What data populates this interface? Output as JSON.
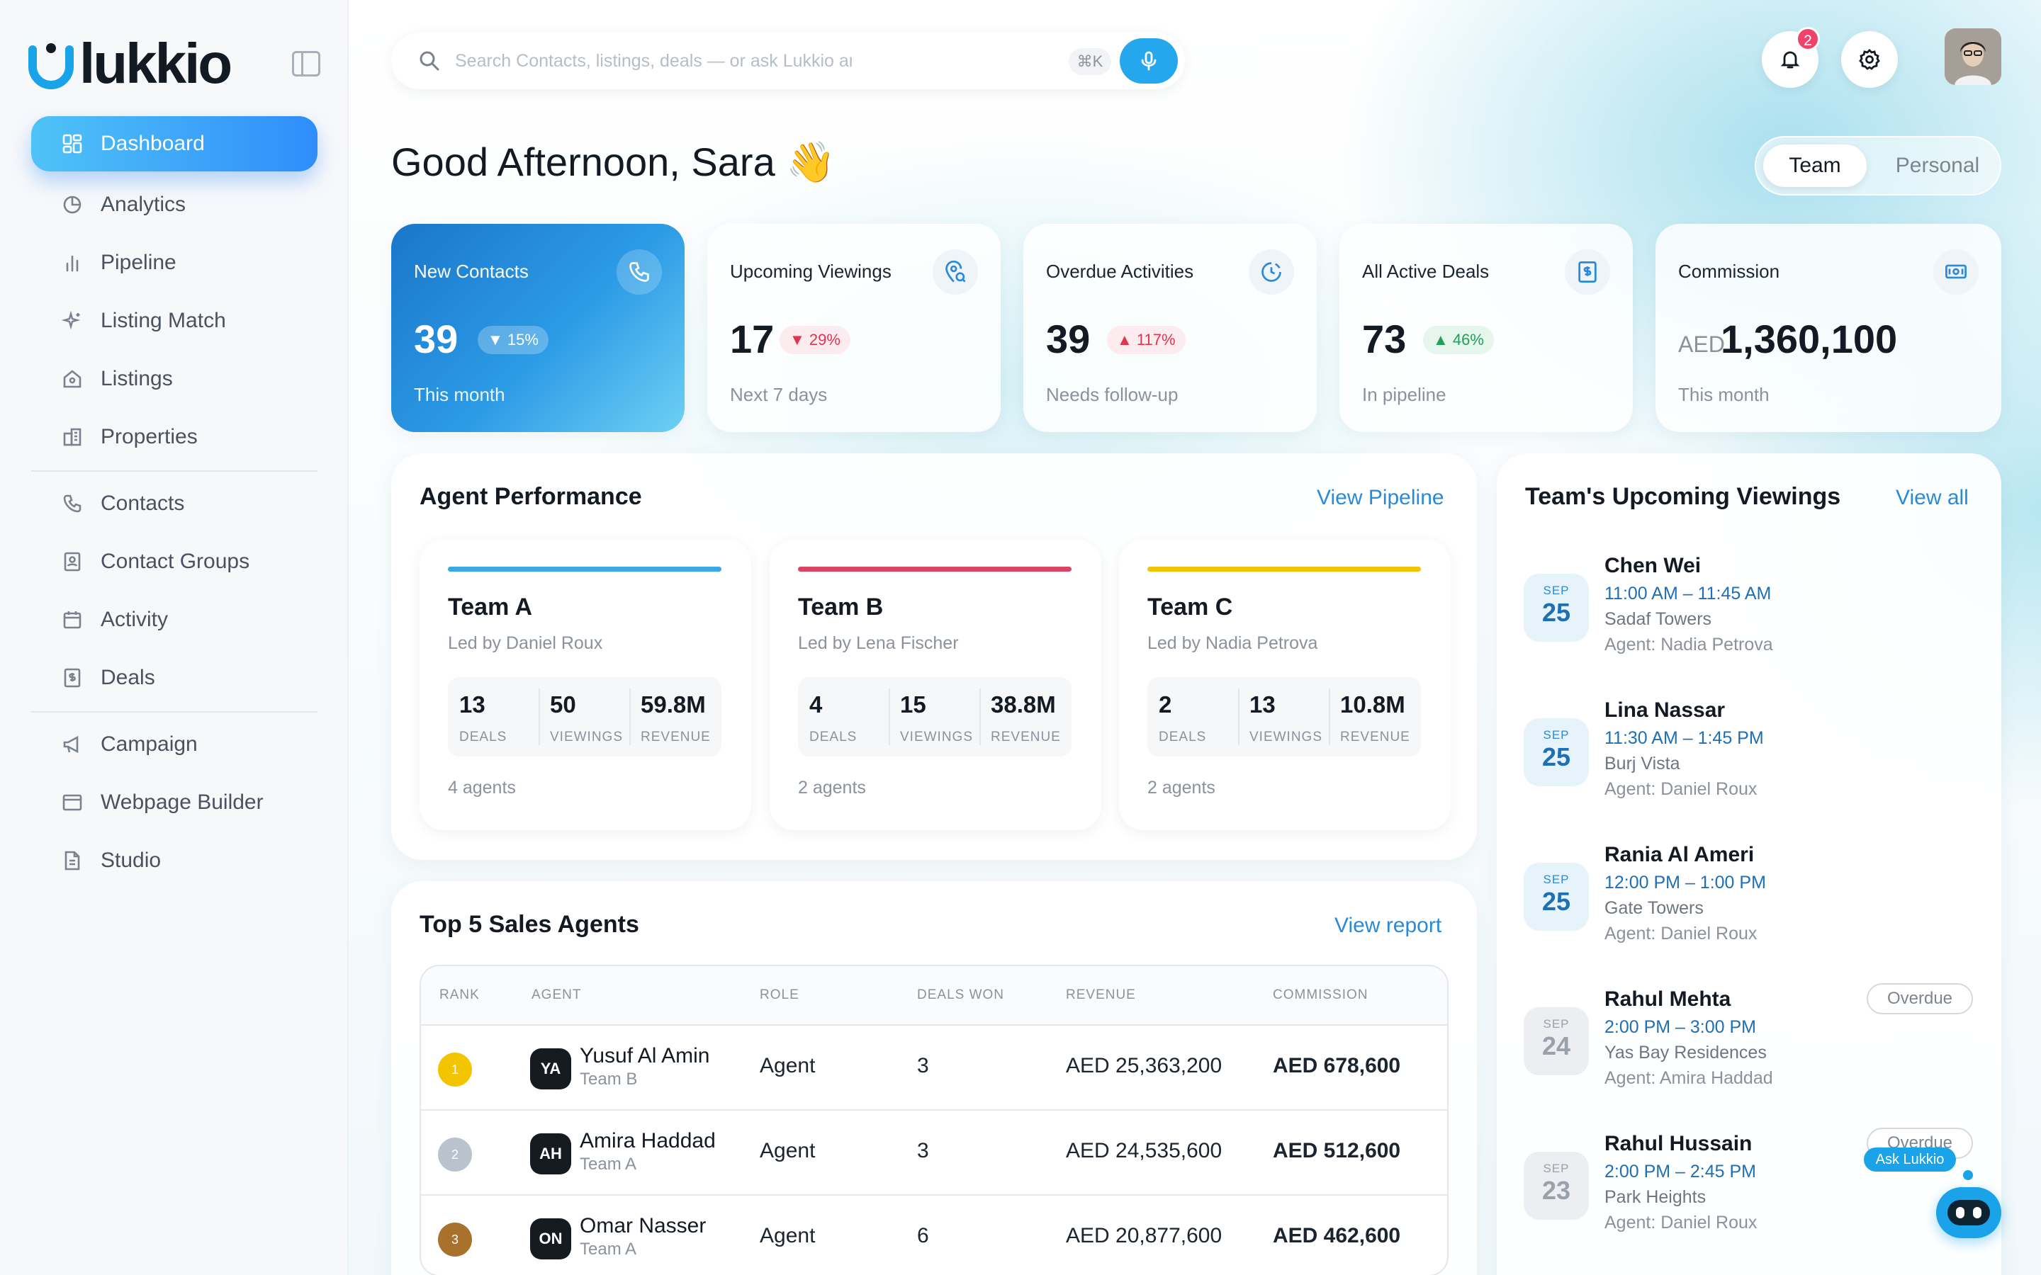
{
  "app": {
    "logo_text": "lukkio"
  },
  "colors": {
    "accent": "#2f8dfa",
    "link": "#2a8ad9",
    "danger": "#e0354f",
    "success": "#21a05a"
  },
  "sidebar": {
    "items": [
      {
        "label": "Dashboard",
        "icon": "grid-icon",
        "active": true
      },
      {
        "label": "Analytics",
        "icon": "pie-chart-icon"
      },
      {
        "label": "Pipeline",
        "icon": "bar-chart-icon"
      },
      {
        "label": "Listing Match",
        "icon": "sparkle-icon"
      },
      {
        "label": "Listings",
        "icon": "house-icon"
      },
      {
        "label": "Properties",
        "icon": "building-icon"
      },
      {
        "label": "Contacts",
        "icon": "phone-icon"
      },
      {
        "label": "Contact Groups",
        "icon": "contact-card-icon"
      },
      {
        "label": "Activity",
        "icon": "calendar-icon"
      },
      {
        "label": "Deals",
        "icon": "dollar-doc-icon"
      },
      {
        "label": "Campaign",
        "icon": "megaphone-icon"
      },
      {
        "label": "Webpage Builder",
        "icon": "browser-icon"
      },
      {
        "label": "Studio",
        "icon": "file-icon"
      }
    ]
  },
  "header": {
    "search_placeholder": "Search Contacts, listings, deals — or ask Lukkio anything",
    "shortcut": "⌘K",
    "notifications_count": "2"
  },
  "greeting": "Good Afternoon, Sara 👋",
  "view_toggle": {
    "selected": "Team",
    "other": "Personal"
  },
  "stats": [
    {
      "title": "New Contacts",
      "value": "39",
      "change": "▼ 15%",
      "sub": "This month",
      "icon": "phone-icon"
    },
    {
      "title": "Upcoming Viewings",
      "value": "17",
      "change": "▼ 29%",
      "sub": "Next 7 days",
      "icon": "location-icon"
    },
    {
      "title": "Overdue Activities",
      "value": "39",
      "change": "▲ 117%",
      "sub": "Needs follow-up",
      "icon": "clock-icon"
    },
    {
      "title": "All Active Deals",
      "value": "73",
      "change": "▲ 46%",
      "sub": "In pipeline",
      "icon": "dollar-doc-icon"
    },
    {
      "title": "Commission",
      "currency": "AED",
      "value": "1,360,100",
      "sub": "This month",
      "icon": "cash-icon"
    }
  ],
  "agent_performance": {
    "title": "Agent Performance",
    "link": "View Pipeline",
    "teams": [
      {
        "name": "Team A",
        "lead": "Led by Daniel Roux",
        "deals": "13",
        "viewings": "50",
        "revenue": "59.8M",
        "agents": "4 agents",
        "color": "#3aa8e6"
      },
      {
        "name": "Team B",
        "lead": "Led by Lena Fischer",
        "deals": "4",
        "viewings": "15",
        "revenue": "38.8M",
        "agents": "2 agents",
        "color": "#d84462"
      },
      {
        "name": "Team C",
        "lead": "Led by Nadia Petrova",
        "deals": "2",
        "viewings": "13",
        "revenue": "10.8M",
        "agents": "2 agents",
        "color": "#f0c400"
      }
    ],
    "labels": {
      "deals": "DEALS",
      "viewings": "VIEWINGS",
      "revenue": "REVENUE"
    }
  },
  "top_agents": {
    "title": "Top 5 Sales Agents",
    "link": "View report",
    "columns": [
      "RANK",
      "AGENT",
      "ROLE",
      "DEALS WON",
      "REVENUE",
      "COMMISSION"
    ],
    "rows": [
      {
        "rank": "1",
        "rank_color": "#f2c500",
        "initials": "YA",
        "name": "Yusuf Al Amin",
        "team": "Team B",
        "role": "Agent",
        "deals": "3",
        "revenue": "AED 25,363,200",
        "commission": "AED 678,600"
      },
      {
        "rank": "2",
        "rank_color": "#b9c2cd",
        "initials": "AH",
        "name": "Amira Haddad",
        "team": "Team A",
        "role": "Agent",
        "deals": "3",
        "revenue": "AED 24,535,600",
        "commission": "AED 512,600"
      },
      {
        "rank": "3",
        "rank_color": "#a8712c",
        "initials": "ON",
        "name": "Omar Nasser",
        "team": "Team A",
        "role": "Agent",
        "deals": "6",
        "revenue": "AED 20,877,600",
        "commission": "AED 462,600"
      }
    ]
  },
  "viewings": {
    "title": "Team's Upcoming Viewings",
    "link": "View all",
    "items": [
      {
        "month": "SEP",
        "day": "25",
        "name": "Chen Wei",
        "time": "11:00 AM – 11:45 AM",
        "place": "Sadaf Towers",
        "agent": "Agent: Nadia Petrova",
        "status": ""
      },
      {
        "month": "SEP",
        "day": "25",
        "name": "Lina Nassar",
        "time": "11:30 AM – 1:45 PM",
        "place": "Burj Vista",
        "agent": "Agent: Daniel Roux",
        "status": ""
      },
      {
        "month": "SEP",
        "day": "25",
        "name": "Rania Al Ameri",
        "time": "12:00 PM – 1:00 PM",
        "place": "Gate Towers",
        "agent": "Agent: Daniel Roux",
        "status": ""
      },
      {
        "month": "SEP",
        "day": "24",
        "name": "Rahul Mehta",
        "time": "2:00 PM – 3:00 PM",
        "place": "Yas Bay Residences",
        "agent": "Agent: Amira Haddad",
        "status": "Overdue"
      },
      {
        "month": "SEP",
        "day": "23",
        "name": "Rahul Hussain",
        "time": "2:00 PM – 2:45 PM",
        "place": "Park Heights",
        "agent": "Agent: Daniel Roux",
        "status": "Overdue"
      }
    ]
  },
  "assistant": {
    "label": "Ask Lukkio"
  }
}
